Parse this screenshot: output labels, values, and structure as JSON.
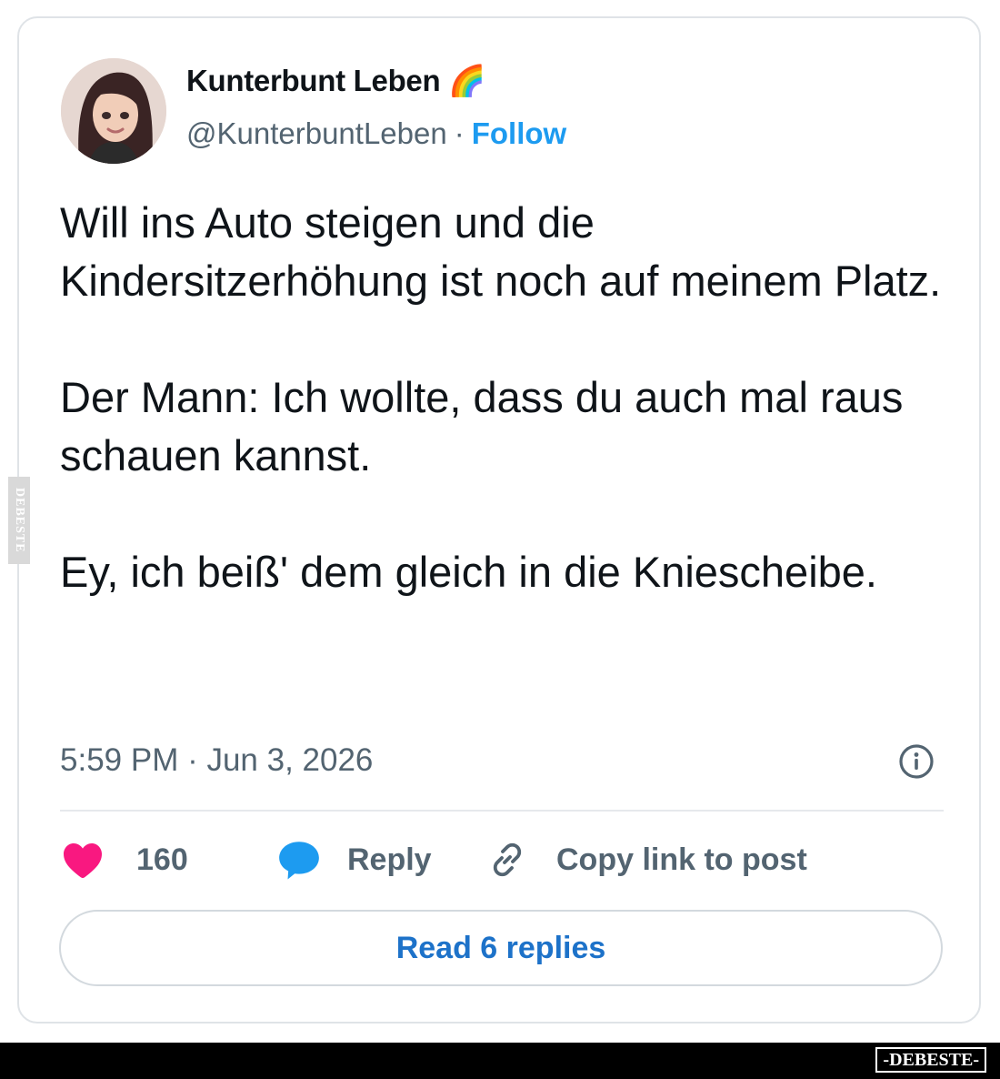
{
  "user": {
    "display_name": "Kunterbunt Leben",
    "name_emoji": "🌈",
    "handle": "@KunterbuntLeben",
    "separator": "·",
    "follow_label": "Follow"
  },
  "tweet": {
    "paragraphs": [
      "Will ins Auto steigen und die Kindersitzerhöhung ist noch auf meinem Platz.",
      "Der Mann: Ich wollte, dass du auch mal raus schauen kannst.",
      "Ey, ich beiß' dem gleich in die Kniescheibe."
    ],
    "timestamp": "5:59 PM · Jun 3, 2026"
  },
  "actions": {
    "like_count": "160",
    "reply_label": "Reply",
    "copy_link_label": "Copy link to post"
  },
  "read_replies_label": "Read 6 replies",
  "watermark": {
    "side_text": "DEBESTE",
    "footer_brand": "-DEBESTE-"
  },
  "colors": {
    "accent": "#1d9bf0",
    "heart": "#f91880",
    "text": "#0f1419",
    "muted": "#536471"
  }
}
